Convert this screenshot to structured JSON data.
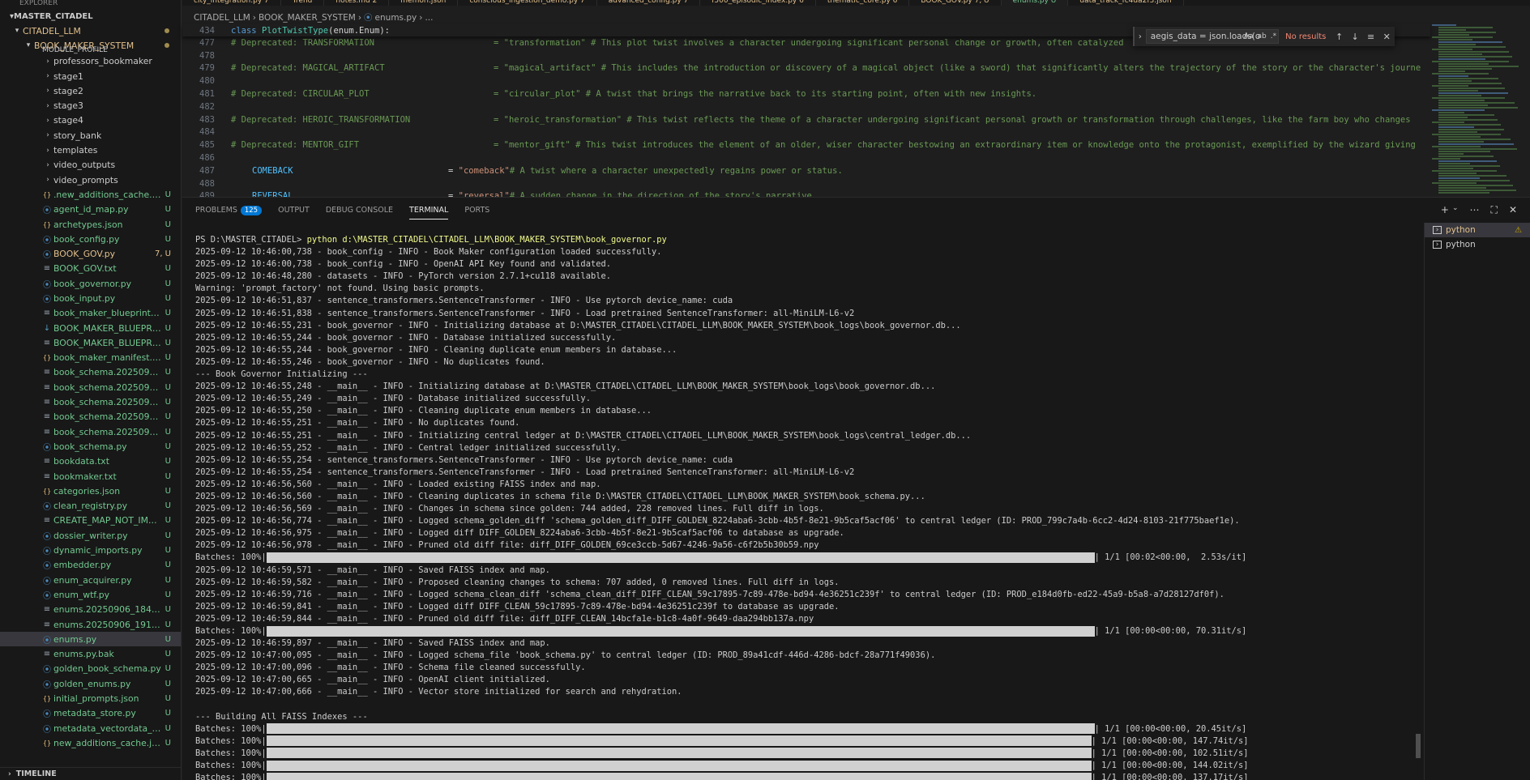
{
  "sidebar": {
    "top_label": "EXPLORER",
    "root": "MASTER_CITADEL",
    "folder1": "CITADEL_LLM",
    "folder2": "BOOK_MAKER_SYSTEM",
    "clipped": "MODULE_PROFILE",
    "items": [
      {
        "type": "folder",
        "label": "professors_bookmaker",
        "status": "",
        "cls": "lbl-plain"
      },
      {
        "type": "folder",
        "label": "stage1",
        "status": "",
        "cls": "lbl-plain"
      },
      {
        "type": "folder",
        "label": "stage2",
        "status": "",
        "cls": "lbl-plain"
      },
      {
        "type": "folder",
        "label": "stage3",
        "status": "",
        "cls": "lbl-plain"
      },
      {
        "type": "folder",
        "label": "stage4",
        "status": "",
        "cls": "lbl-plain"
      },
      {
        "type": "folder",
        "label": "story_bank",
        "status": "",
        "cls": "lbl-plain"
      },
      {
        "type": "folder",
        "label": "templates",
        "status": "",
        "cls": "lbl-plain"
      },
      {
        "type": "folder",
        "label": "video_outputs",
        "status": "",
        "cls": "lbl-plain"
      },
      {
        "type": "folder",
        "label": "video_prompts",
        "status": "",
        "cls": "lbl-plain"
      },
      {
        "type": "json",
        "label": ".new_additions_cache.json",
        "status": "U",
        "cls": "lbl-mod"
      },
      {
        "type": "py",
        "label": "agent_id_map.py",
        "status": "U",
        "cls": "lbl-mod"
      },
      {
        "type": "json",
        "label": "archetypes.json",
        "status": "U",
        "cls": "lbl-mod"
      },
      {
        "type": "py",
        "label": "book_config.py",
        "status": "U",
        "cls": "lbl-mod"
      },
      {
        "type": "py",
        "label": "BOOK_GOV.py",
        "status": "7, U",
        "cls": "lbl-warn"
      },
      {
        "type": "txt",
        "label": "BOOK_GOV.txt",
        "status": "U",
        "cls": "lbl-mod"
      },
      {
        "type": "py",
        "label": "book_governor.py",
        "status": "U",
        "cls": "lbl-mod"
      },
      {
        "type": "py",
        "label": "book_input.py",
        "status": "U",
        "cls": "lbl-mod"
      },
      {
        "type": "txt",
        "label": "book_maker_blueprint_v3.txt",
        "status": "U",
        "cls": "lbl-mod"
      },
      {
        "type": "md",
        "label": "BOOK_MAKER_BLUEPRINT.md",
        "status": "U",
        "cls": "lbl-mod"
      },
      {
        "type": "txt",
        "label": "BOOK_MAKER_BLUEPRINT.txt",
        "status": "U",
        "cls": "lbl-mod"
      },
      {
        "type": "json",
        "label": "book_maker_manifest.json",
        "status": "U",
        "cls": "lbl-mod"
      },
      {
        "type": "txt",
        "label": "book_schema.20250905_220...",
        "status": "U",
        "cls": "lbl-mod"
      },
      {
        "type": "txt",
        "label": "book_schema.20250905_222...",
        "status": "U",
        "cls": "lbl-mod"
      },
      {
        "type": "txt",
        "label": "book_schema.20250905_222...",
        "status": "U",
        "cls": "lbl-mod"
      },
      {
        "type": "txt",
        "label": "book_schema.20250905_235...",
        "status": "U",
        "cls": "lbl-mod"
      },
      {
        "type": "txt",
        "label": "book_schema.20250905_235...",
        "status": "U",
        "cls": "lbl-mod"
      },
      {
        "type": "py",
        "label": "book_schema.py",
        "status": "U",
        "cls": "lbl-mod"
      },
      {
        "type": "txt",
        "label": "bookdata.txt",
        "status": "U",
        "cls": "lbl-mod"
      },
      {
        "type": "txt",
        "label": "bookmaker.txt",
        "status": "U",
        "cls": "lbl-mod"
      },
      {
        "type": "json",
        "label": "categories.json",
        "status": "U",
        "cls": "lbl-mod"
      },
      {
        "type": "py",
        "label": "clean_registry.py",
        "status": "U",
        "cls": "lbl-mod"
      },
      {
        "type": "txt",
        "label": "CREATE_MAP_NOT_IMPLIME...",
        "status": "U",
        "cls": "lbl-mod"
      },
      {
        "type": "py",
        "label": "dossier_writer.py",
        "status": "U",
        "cls": "lbl-mod"
      },
      {
        "type": "py",
        "label": "dynamic_imports.py",
        "status": "U",
        "cls": "lbl-mod"
      },
      {
        "type": "py",
        "label": "embedder.py",
        "status": "U",
        "cls": "lbl-mod"
      },
      {
        "type": "py",
        "label": "enum_acquirer.py",
        "status": "U",
        "cls": "lbl-mod"
      },
      {
        "type": "py",
        "label": "enum_wtf.py",
        "status": "U",
        "cls": "lbl-mod"
      },
      {
        "type": "txt",
        "label": "enums.20250906_184709.bak",
        "status": "U",
        "cls": "lbl-mod"
      },
      {
        "type": "txt",
        "label": "enums.20250906_191106.bak",
        "status": "U",
        "cls": "lbl-mod"
      },
      {
        "type": "py",
        "label": "enums.py",
        "status": "U",
        "cls": "lbl-mod",
        "active": true
      },
      {
        "type": "txt",
        "label": "enums.py.bak",
        "status": "U",
        "cls": "lbl-mod"
      },
      {
        "type": "py",
        "label": "golden_book_schema.py",
        "status": "U",
        "cls": "lbl-mod"
      },
      {
        "type": "py",
        "label": "golden_enums.py",
        "status": "U",
        "cls": "lbl-mod"
      },
      {
        "type": "json",
        "label": "initial_prompts.json",
        "status": "U",
        "cls": "lbl-mod"
      },
      {
        "type": "py",
        "label": "metadata_store.py",
        "status": "U",
        "cls": "lbl-mod"
      },
      {
        "type": "py",
        "label": "metadata_vectordata_store.py",
        "status": "U",
        "cls": "lbl-mod"
      },
      {
        "type": "json",
        "label": "new_additions_cache.json",
        "status": "U",
        "cls": "lbl-mod"
      }
    ],
    "timeline": "TIMELINE"
  },
  "tabs": [
    {
      "label": "city_integration.py 7",
      "active": false
    },
    {
      "label": "Trend",
      "active": false
    },
    {
      "label": "notes.md 2",
      "active": false
    },
    {
      "label": "memori.json",
      "active": false
    },
    {
      "label": "conscious_ingestion_demo.py 7",
      "active": false
    },
    {
      "label": "advanced_config.py 7",
      "active": false
    },
    {
      "label": "f500_episodic_index.py 6",
      "active": false
    },
    {
      "label": "thematic_core.py 6",
      "active": false
    },
    {
      "label": "BOOK_GOV.py 7, U",
      "active": false
    },
    {
      "label": "enums.py U",
      "active": true
    },
    {
      "label": "data_track_fc4da2f3.json",
      "active": false
    }
  ],
  "breadcrumb": {
    "p1": "CITADEL_LLM",
    "p2": "BOOK_MAKER_SYSTEM",
    "p3": "enums.py",
    "p4": "..."
  },
  "editor": {
    "sticky": {
      "ln": "434",
      "kw": "class",
      "name": "PlotTwistType",
      "args": "(enum.Enum):"
    },
    "lines": [
      {
        "ln": "477",
        "kind": "dep",
        "name": "# Deprecated: TRANSFORMATION",
        "val": "= \"transformation\" # This plot twist involves a character undergoing significant personal change or growth, often catalyzed"
      },
      {
        "ln": "478",
        "kind": "blank"
      },
      {
        "ln": "479",
        "kind": "dep",
        "name": "# Deprecated: MAGICAL_ARTIFACT",
        "val": "= \"magical_artifact\" # This includes the introduction or discovery of a magical object (like a sword) that significantly alters the trajectory of the story or the character's journe"
      },
      {
        "ln": "480",
        "kind": "blank"
      },
      {
        "ln": "481",
        "kind": "dep",
        "name": "# Deprecated: CIRCULAR_PLOT",
        "val": "= \"circular_plot\" # A twist that brings the narrative back to its starting point, often with new insights."
      },
      {
        "ln": "482",
        "kind": "blank"
      },
      {
        "ln": "483",
        "kind": "dep",
        "name": "# Deprecated: HEROIC_TRANSFORMATION",
        "val": "= \"heroic_transformation\" # This twist reflects the theme of a character undergoing significant personal growth or transformation through challenges, like the farm boy who changes"
      },
      {
        "ln": "484",
        "kind": "blank"
      },
      {
        "ln": "485",
        "kind": "dep",
        "name": "# Deprecated: MENTOR_GIFT",
        "val": "= \"mentor_gift\" # This twist introduces the element of an older, wiser character bestowing an extraordinary item or knowledge onto the protagonist, exemplified by the wizard giving"
      },
      {
        "ln": "486",
        "kind": "blank"
      },
      {
        "ln": "487",
        "kind": "member",
        "name": "COMEBACK",
        "str": "\"comeback\"",
        "cm": "# A twist where a character unexpectedly regains power or status."
      },
      {
        "ln": "488",
        "kind": "blank"
      },
      {
        "ln": "489",
        "kind": "member",
        "name": "REVERSAL",
        "str": "\"reversal\"",
        "cm": "# A sudden change in the direction of the story's narrative."
      }
    ]
  },
  "find": {
    "query": "aegis_data = json.loads(o",
    "result": "No results",
    "opt1": "Aa",
    "opt2": "ab",
    "opt3": ".*"
  },
  "panel": {
    "tabs": [
      {
        "label": "PROBLEMS",
        "badge": "125"
      },
      {
        "label": "OUTPUT"
      },
      {
        "label": "DEBUG CONSOLE"
      },
      {
        "label": "TERMINAL",
        "active": true
      },
      {
        "label": "PORTS"
      }
    ],
    "terminals": [
      {
        "label": "python",
        "active": true
      },
      {
        "label": "python",
        "active": false
      }
    ]
  },
  "terminal": {
    "prompt": "PS D:\\MASTER_CITADEL> ",
    "cmd": "python d:\\MASTER_CITADEL\\CITADEL_LLM\\BOOK_MAKER_SYSTEM\\book_governor.py",
    "lines": [
      {
        "t": "2025-09-12 10:46:00,738 - book_config - INFO - Book Maker configuration loaded successfully."
      },
      {
        "t": "2025-09-12 10:46:00,738 - book_config - INFO - OpenAI API Key found and validated."
      },
      {
        "t": "2025-09-12 10:46:48,280 - datasets - INFO - PyTorch version 2.7.1+cu118 available."
      },
      {
        "t": "Warning: 'prompt_factory' not found. Using basic prompts."
      },
      {
        "t": "2025-09-12 10:46:51,837 - sentence_transformers.SentenceTransformer - INFO - Use pytorch device_name: cuda"
      },
      {
        "t": "2025-09-12 10:46:51,838 - sentence_transformers.SentenceTransformer - INFO - Load pretrained SentenceTransformer: all-MiniLM-L6-v2"
      },
      {
        "t": "2025-09-12 10:46:55,231 - book_governor - INFO - Initializing database at D:\\MASTER_CITADEL\\CITADEL_LLM\\BOOK_MAKER_SYSTEM\\book_logs\\book_governor.db..."
      },
      {
        "t": "2025-09-12 10:46:55,244 - book_governor - INFO - Database initialized successfully."
      },
      {
        "t": "2025-09-12 10:46:55,244 - book_governor - INFO - Cleaning duplicate enum members in database..."
      },
      {
        "t": "2025-09-12 10:46:55,246 - book_governor - INFO - No duplicates found."
      },
      {
        "t": "--- Book Governor Initializing ---"
      },
      {
        "t": "2025-09-12 10:46:55,248 - __main__ - INFO - Initializing database at D:\\MASTER_CITADEL\\CITADEL_LLM\\BOOK_MAKER_SYSTEM\\book_logs\\book_governor.db..."
      },
      {
        "t": "2025-09-12 10:46:55,249 - __main__ - INFO - Database initialized successfully."
      },
      {
        "t": "2025-09-12 10:46:55,250 - __main__ - INFO - Cleaning duplicate enum members in database..."
      },
      {
        "t": "2025-09-12 10:46:55,251 - __main__ - INFO - No duplicates found."
      },
      {
        "t": "2025-09-12 10:46:55,251 - __main__ - INFO - Initializing central ledger at D:\\MASTER_CITADEL\\CITADEL_LLM\\BOOK_MAKER_SYSTEM\\book_logs\\central_ledger.db..."
      },
      {
        "t": "2025-09-12 10:46:55,252 - __main__ - INFO - Central ledger initialized successfully."
      },
      {
        "t": "2025-09-12 10:46:55,254 - sentence_transformers.SentenceTransformer - INFO - Use pytorch device_name: cuda"
      },
      {
        "t": "2025-09-12 10:46:55,254 - sentence_transformers.SentenceTransformer - INFO - Load pretrained SentenceTransformer: all-MiniLM-L6-v2"
      },
      {
        "t": "2025-09-12 10:46:56,560 - __main__ - INFO - Loaded existing FAISS index and map."
      },
      {
        "t": "2025-09-12 10:46:56,560 - __main__ - INFO - Cleaning duplicates in schema file D:\\MASTER_CITADEL\\CITADEL_LLM\\BOOK_MAKER_SYSTEM\\book_schema.py..."
      },
      {
        "t": "2025-09-12 10:46:56,569 - __main__ - INFO - Changes in schema since golden: 744 added, 228 removed lines. Full diff in logs."
      },
      {
        "t": "2025-09-12 10:46:56,774 - __main__ - INFO - Logged schema_golden_diff 'schema_golden_diff_DIFF_GOLDEN_8224aba6-3cbb-4b5f-8e21-9b5caf5acf06' to central ledger (ID: PROD_799c7a4b-6cc2-4d24-8103-21f775baef1e)."
      },
      {
        "t": "2025-09-12 10:46:56,975 - __main__ - INFO - Logged diff DIFF_GOLDEN_8224aba6-3cbb-4b5f-8e21-9b5caf5acf06 to database as upgrade."
      },
      {
        "t": "2025-09-12 10:46:56,978 - __main__ - INFO - Pruned old diff file: diff_DIFF_GOLDEN_69ce3ccb-5d67-4246-9a56-c6f2b5b30b59.npy"
      },
      {
        "pre": "Batches: 100%|",
        "bar": 1022,
        "post": "| 1/1 [00:02<00:00,  2.53s/it]"
      },
      {
        "t": "2025-09-12 10:46:59,571 - __main__ - INFO - Saved FAISS index and map."
      },
      {
        "t": "2025-09-12 10:46:59,582 - __main__ - INFO - Proposed cleaning changes to schema: 707 added, 0 removed lines. Full diff in logs."
      },
      {
        "t": "2025-09-12 10:46:59,716 - __main__ - INFO - Logged schema_clean_diff 'schema_clean_diff_DIFF_CLEAN_59c17895-7c89-478e-bd94-4e36251c239f' to central ledger (ID: PROD_e184d0fb-ed22-45a9-b5a8-a7d28127df0f)."
      },
      {
        "t": "2025-09-12 10:46:59,841 - __main__ - INFO - Logged diff DIFF_CLEAN_59c17895-7c89-478e-bd94-4e36251c239f to database as upgrade."
      },
      {
        "t": "2025-09-12 10:46:59,844 - __main__ - INFO - Pruned old diff file: diff_DIFF_CLEAN_14bcfa1e-b1c8-4a0f-9649-daa294bb137a.npy"
      },
      {
        "pre": "Batches: 100%|",
        "bar": 1022,
        "post": "| 1/1 [00:00<00:00, 70.31it/s]"
      },
      {
        "t": "2025-09-12 10:46:59,897 - __main__ - INFO - Saved FAISS index and map."
      },
      {
        "t": "2025-09-12 10:47:00,095 - __main__ - INFO - Logged schema_file 'book_schema.py' to central ledger (ID: PROD_89a41cdf-446d-4286-bdcf-28a771f49036)."
      },
      {
        "t": "2025-09-12 10:47:00,096 - __main__ - INFO - Schema file cleaned successfully."
      },
      {
        "t": "2025-09-12 10:47:00,665 - __main__ - INFO - OpenAI client initialized."
      },
      {
        "t": "2025-09-12 10:47:00,666 - __main__ - INFO - Vector store initialized for search and rehydration."
      },
      {
        "t": ""
      },
      {
        "t": "--- Building All FAISS Indexes ---"
      },
      {
        "pre": "Batches: 100%|",
        "bar": 1022,
        "post": "| 1/1 [00:00<00:00, 20.45it/s]"
      },
      {
        "pre": "Batches: 100%|",
        "bar": 1018,
        "post": "| 1/1 [00:00<00:00, 147.74it/s]"
      },
      {
        "pre": "Batches: 100%|",
        "bar": 1018,
        "post": "| 1/1 [00:00<00:00, 102.51it/s]"
      },
      {
        "pre": "Batches: 100%|",
        "bar": 1018,
        "post": "| 1/1 [00:00<00:00, 144.02it/s]"
      },
      {
        "pre": "Batches: 100%|",
        "bar": 1018,
        "post": "| 1/1 [00:00<00:00, 137.17it/s]"
      }
    ]
  }
}
